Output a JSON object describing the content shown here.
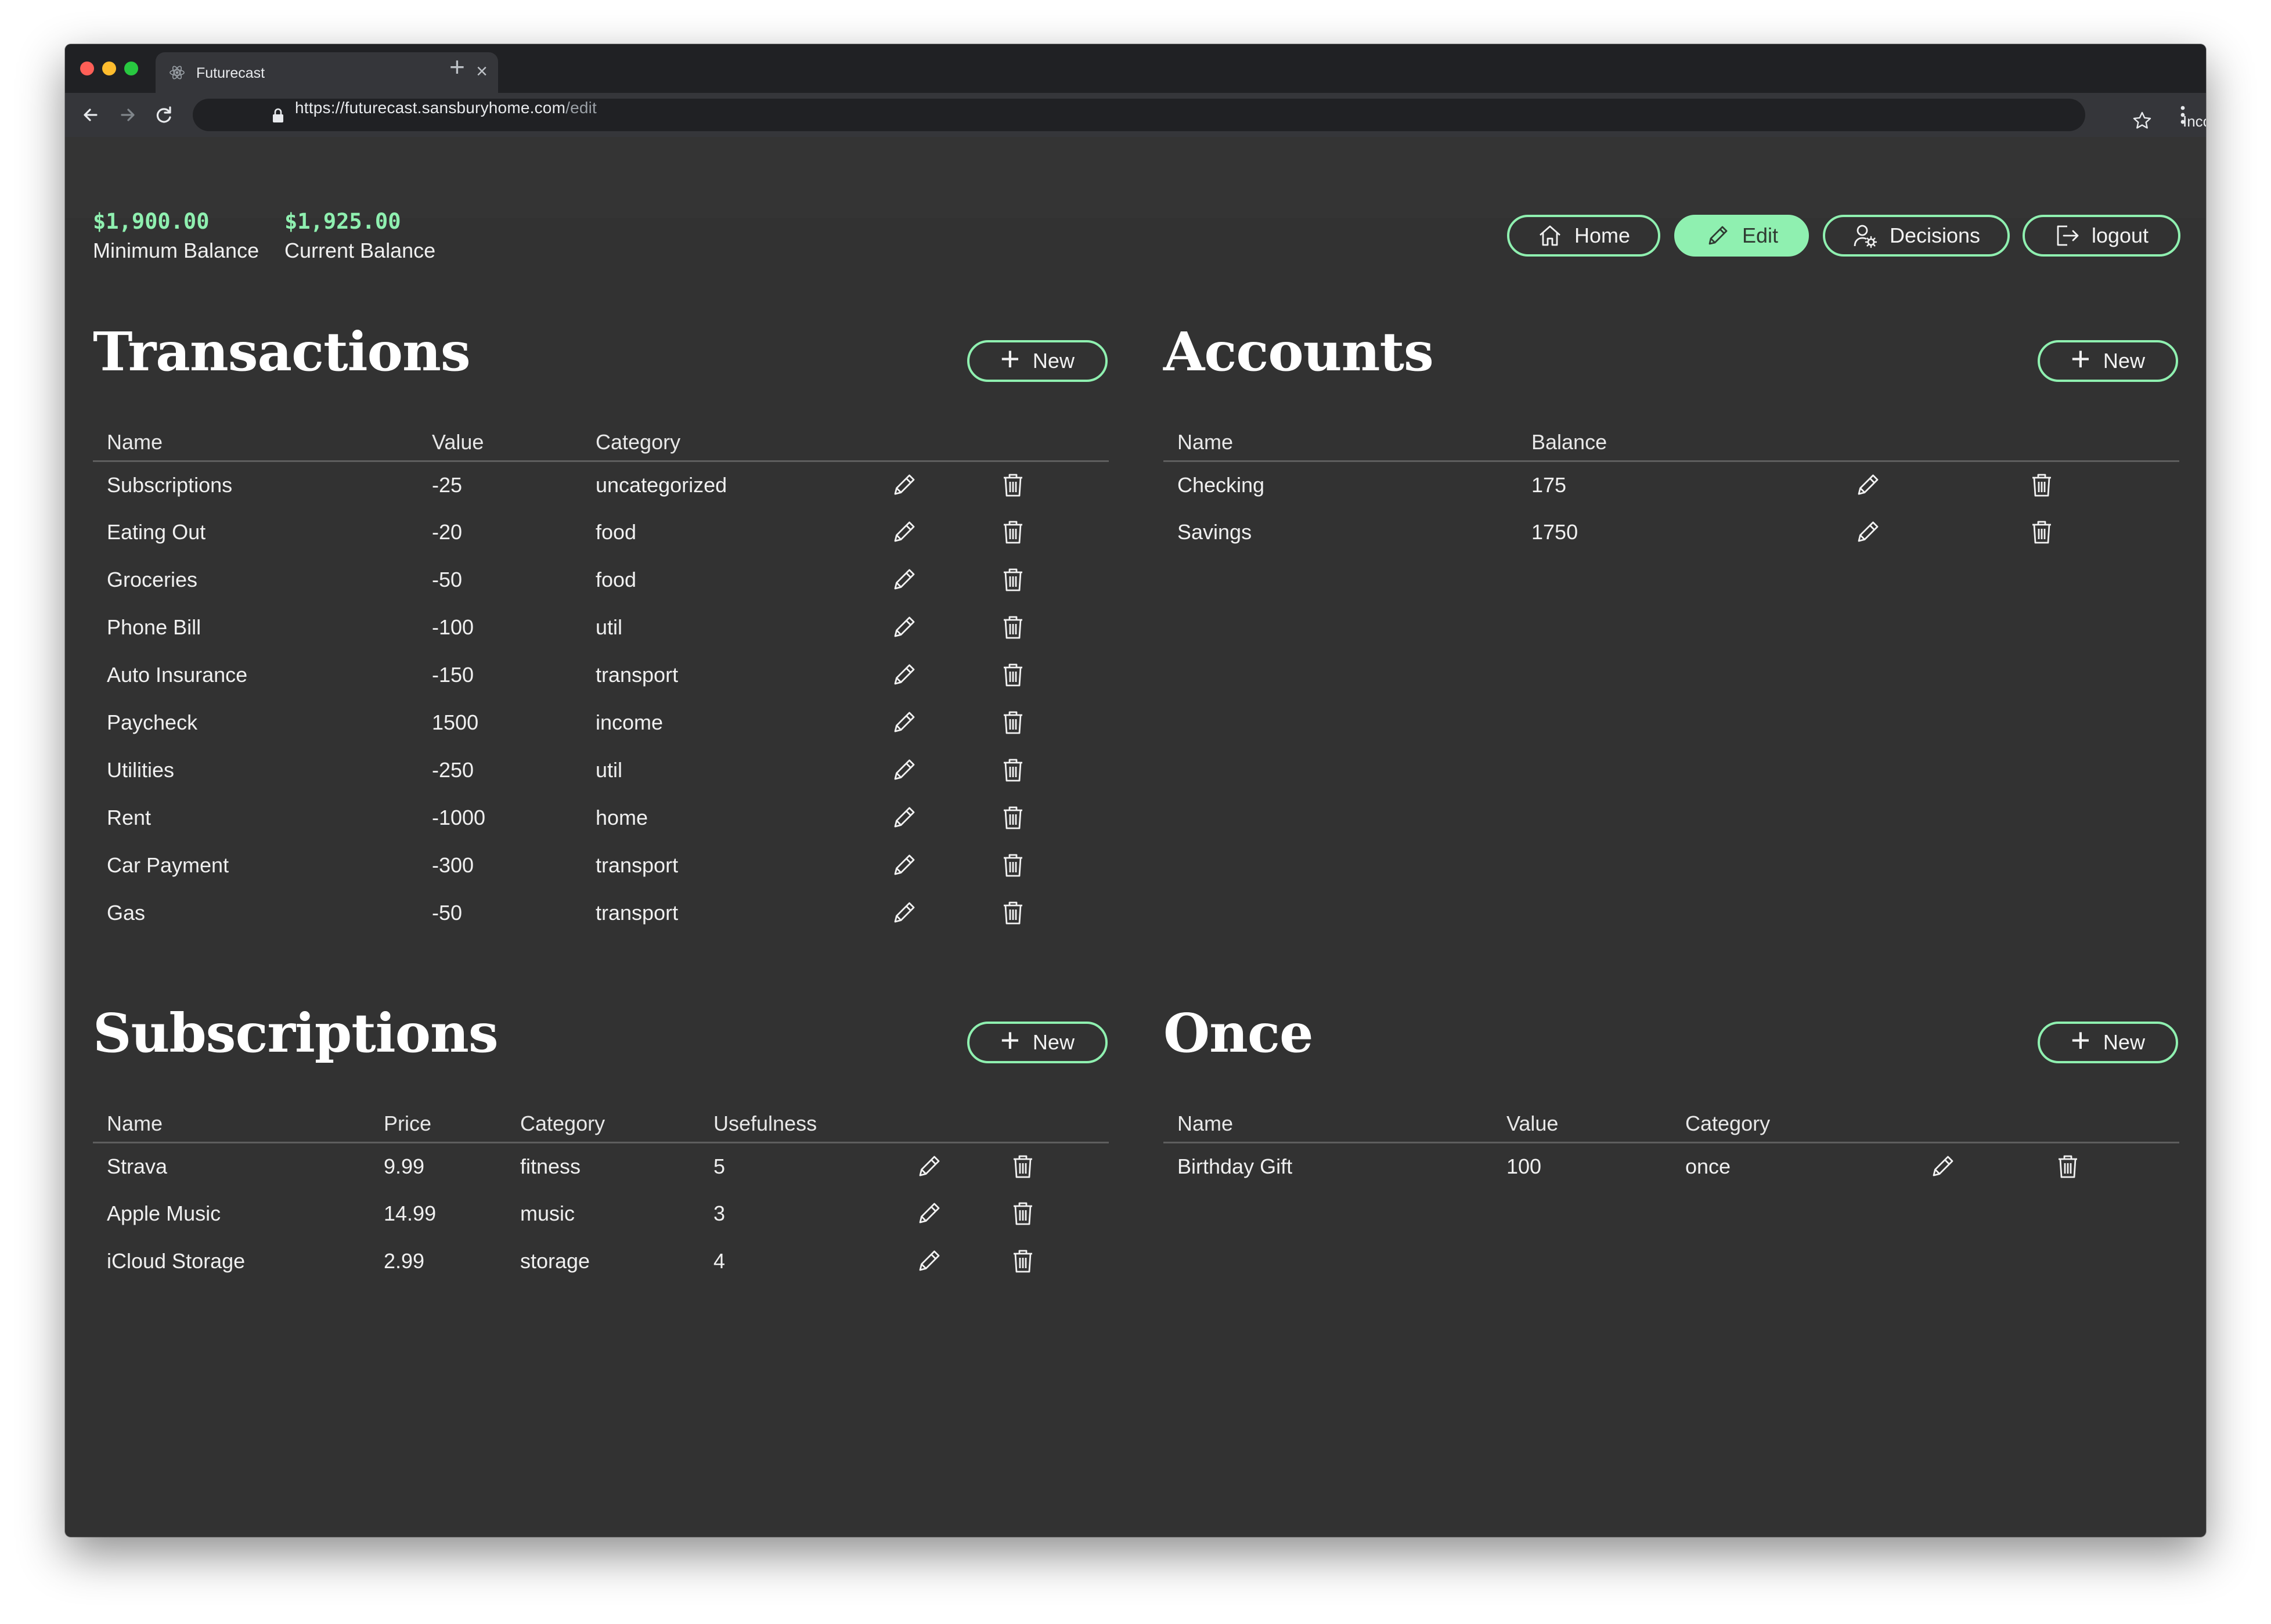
{
  "browser": {
    "tab_title": "Futurecast",
    "url_main": "https://futurecast.sansburyhome.com",
    "url_path": "/edit",
    "incognito_label": "Incognito"
  },
  "balances": {
    "minimum_value": "$1,900.00",
    "minimum_label": "Minimum Balance",
    "current_value": "$1,925.00",
    "current_label": "Current Balance"
  },
  "nav": {
    "home": "Home",
    "edit": "Edit",
    "decisions": "Decisions",
    "logout": "logout",
    "active": "Edit"
  },
  "new_label": "New",
  "transactions": {
    "title": "Transactions",
    "headers": [
      "Name",
      "Value",
      "Category"
    ],
    "rows": [
      [
        "Subscriptions",
        "-25",
        "uncategorized"
      ],
      [
        "Eating Out",
        "-20",
        "food"
      ],
      [
        "Groceries",
        "-50",
        "food"
      ],
      [
        "Phone Bill",
        "-100",
        "util"
      ],
      [
        "Auto Insurance",
        "-150",
        "transport"
      ],
      [
        "Paycheck",
        "1500",
        "income"
      ],
      [
        "Utilities",
        "-250",
        "util"
      ],
      [
        "Rent",
        "-1000",
        "home"
      ],
      [
        "Car Payment",
        "-300",
        "transport"
      ],
      [
        "Gas",
        "-50",
        "transport"
      ]
    ]
  },
  "accounts": {
    "title": "Accounts",
    "headers": [
      "Name",
      "Balance"
    ],
    "rows": [
      [
        "Checking",
        "175"
      ],
      [
        "Savings",
        "1750"
      ]
    ]
  },
  "subscriptions": {
    "title": "Subscriptions",
    "headers": [
      "Name",
      "Price",
      "Category",
      "Usefulness"
    ],
    "rows": [
      [
        "Strava",
        "9.99",
        "fitness",
        "5"
      ],
      [
        "Apple Music",
        "14.99",
        "music",
        "3"
      ],
      [
        "iCloud Storage",
        "2.99",
        "storage",
        "4"
      ]
    ]
  },
  "once": {
    "title": "Once",
    "headers": [
      "Name",
      "Value",
      "Category"
    ],
    "rows": [
      [
        "Birthday Gift",
        "100",
        "once"
      ]
    ]
  },
  "colors": {
    "accent": "#8ff0b0",
    "background": "#323232",
    "text": "#f0f0f0"
  },
  "icons": [
    "react-favicon-icon",
    "back-arrow-icon",
    "forward-arrow-icon",
    "reload-icon",
    "lock-icon",
    "star-icon",
    "incognito-icon",
    "menu-dots-icon",
    "home-icon",
    "pencil-icon",
    "user-gear-icon",
    "logout-icon",
    "plus-icon",
    "trash-icon"
  ]
}
